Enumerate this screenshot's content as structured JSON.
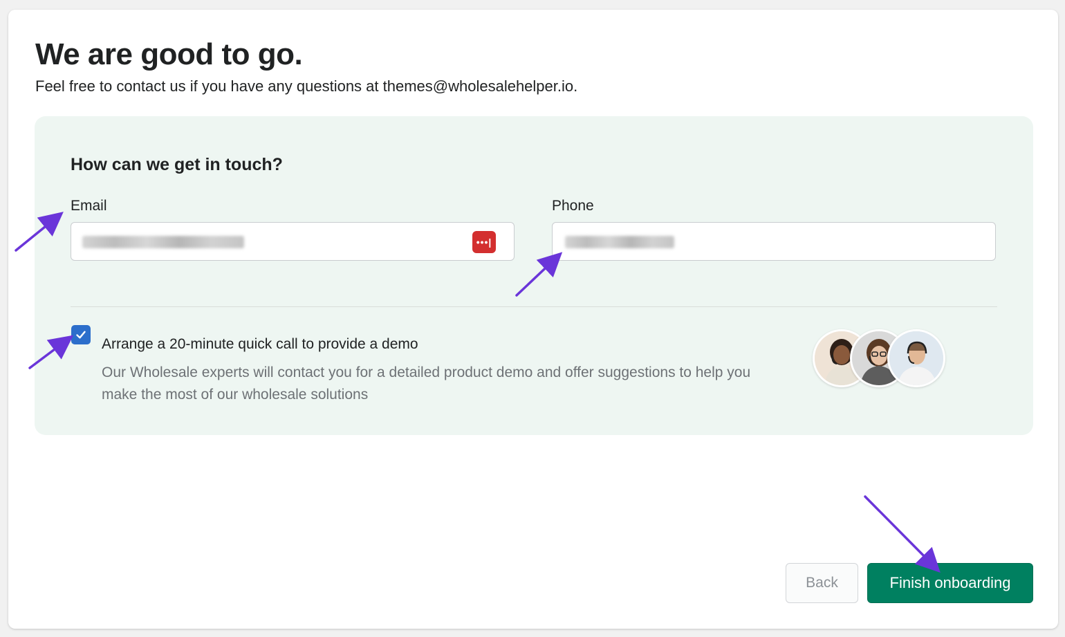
{
  "page": {
    "title": "We are good to go.",
    "subtitle": "Feel free to contact us if you have any questions at themes@wholesalehelper.io."
  },
  "contact": {
    "heading": "How can we get in touch?",
    "email_label": "Email",
    "phone_label": "Phone",
    "password_manager_icon": "password-manager-dots",
    "password_manager_glyph": "•••|"
  },
  "demo": {
    "checked": true,
    "title": "Arrange a 20-minute quick call to provide a demo",
    "description": "Our Wholesale experts will contact you for a detailed product demo and offer suggestions to help you make the most of our wholesale solutions"
  },
  "actions": {
    "back_label": "Back",
    "finish_label": "Finish onboarding"
  },
  "colors": {
    "primary": "#008060",
    "checkbox": "#2c6ecb",
    "panel_bg": "#eef6f2",
    "annotation_arrow": "#6a35d9",
    "password_icon": "#d32f2f"
  }
}
